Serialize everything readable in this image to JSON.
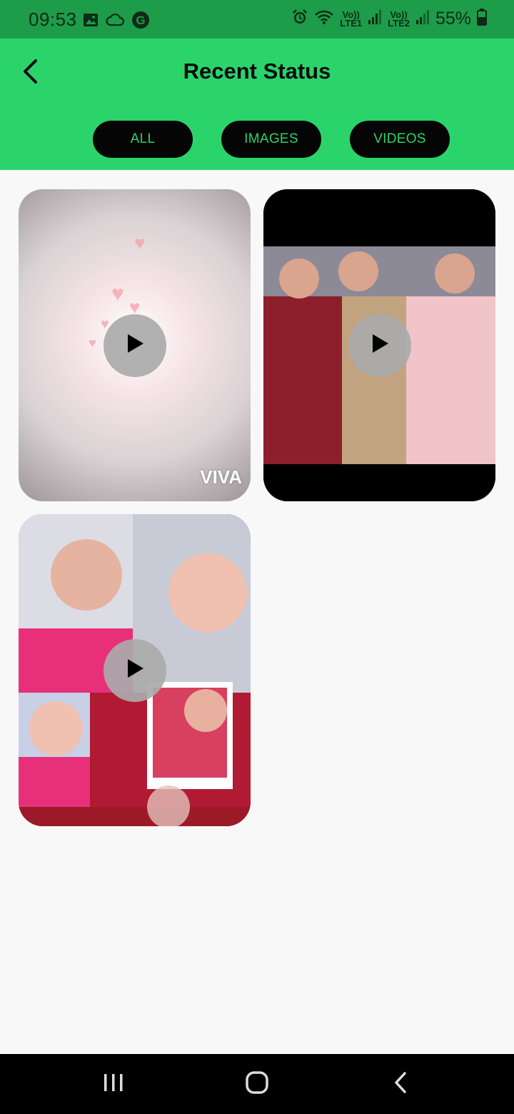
{
  "status_bar": {
    "time": "09:53",
    "left_icons": [
      "gallery-icon",
      "cloud-icon",
      "g-icon"
    ],
    "signal1_top": "Vo))",
    "signal1_bottom": "LTE1",
    "signal2_top": "Vo))",
    "signal2_bottom": "LTE2",
    "battery": "55%"
  },
  "header": {
    "title": "Recent Status",
    "tabs": [
      "ALL",
      "IMAGES",
      "VIDEOS"
    ]
  },
  "grid": {
    "items": [
      {
        "type": "video",
        "watermark": "VIVA"
      },
      {
        "type": "video"
      },
      {
        "type": "video"
      }
    ]
  },
  "colors": {
    "status_bar": "#1d9c4a",
    "header": "#2ad46b",
    "tab_bg": "#050505",
    "tab_text": "#2ad46b",
    "background": "#f8f8f8"
  }
}
